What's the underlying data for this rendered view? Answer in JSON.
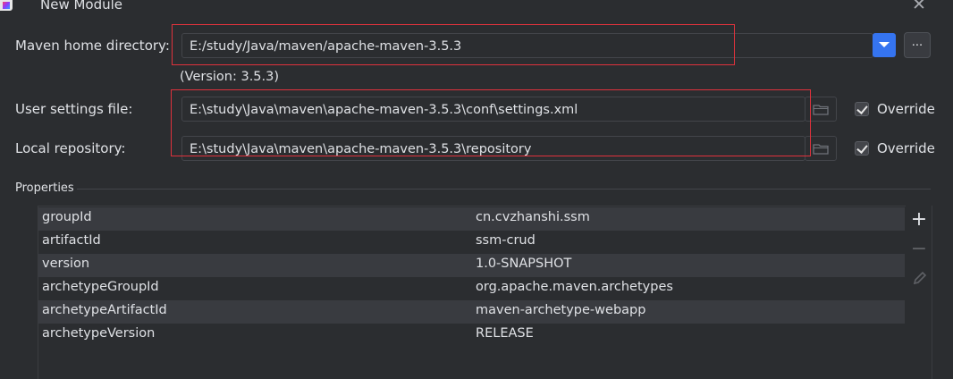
{
  "window": {
    "title": "New Module",
    "close_glyph": "✕"
  },
  "maven_home": {
    "label": "Maven home directory:",
    "value": "E:/study/Java/maven/apache-maven-3.5.3",
    "browse_label": "...",
    "version_note": "(Version: 3.5.3)"
  },
  "user_settings": {
    "label": "User settings file:",
    "value": "E:\\study\\Java\\maven\\apache-maven-3.5.3\\conf\\settings.xml",
    "override_label": "Override",
    "override_checked": true
  },
  "local_repo": {
    "label": "Local repository:",
    "value": "E:\\study\\Java\\maven\\apache-maven-3.5.3\\repository",
    "override_label": "Override",
    "override_checked": true
  },
  "properties": {
    "title": "Properties",
    "rows": [
      {
        "key": "groupId",
        "value": "cn.cvzhanshi.ssm"
      },
      {
        "key": "artifactId",
        "value": "ssm-crud"
      },
      {
        "key": "version",
        "value": "1.0-SNAPSHOT"
      },
      {
        "key": "archetypeGroupId",
        "value": "org.apache.maven.archetypes"
      },
      {
        "key": "archetypeArtifactId",
        "value": "maven-archetype-webapp"
      },
      {
        "key": "archetypeVersion",
        "value": "RELEASE"
      }
    ],
    "tools": {
      "add": "+",
      "remove": "−"
    }
  },
  "colors": {
    "background": "#2b2d30",
    "accent": "#3574f0",
    "highlight": "#e0323c",
    "row_alt": "#393b40"
  }
}
